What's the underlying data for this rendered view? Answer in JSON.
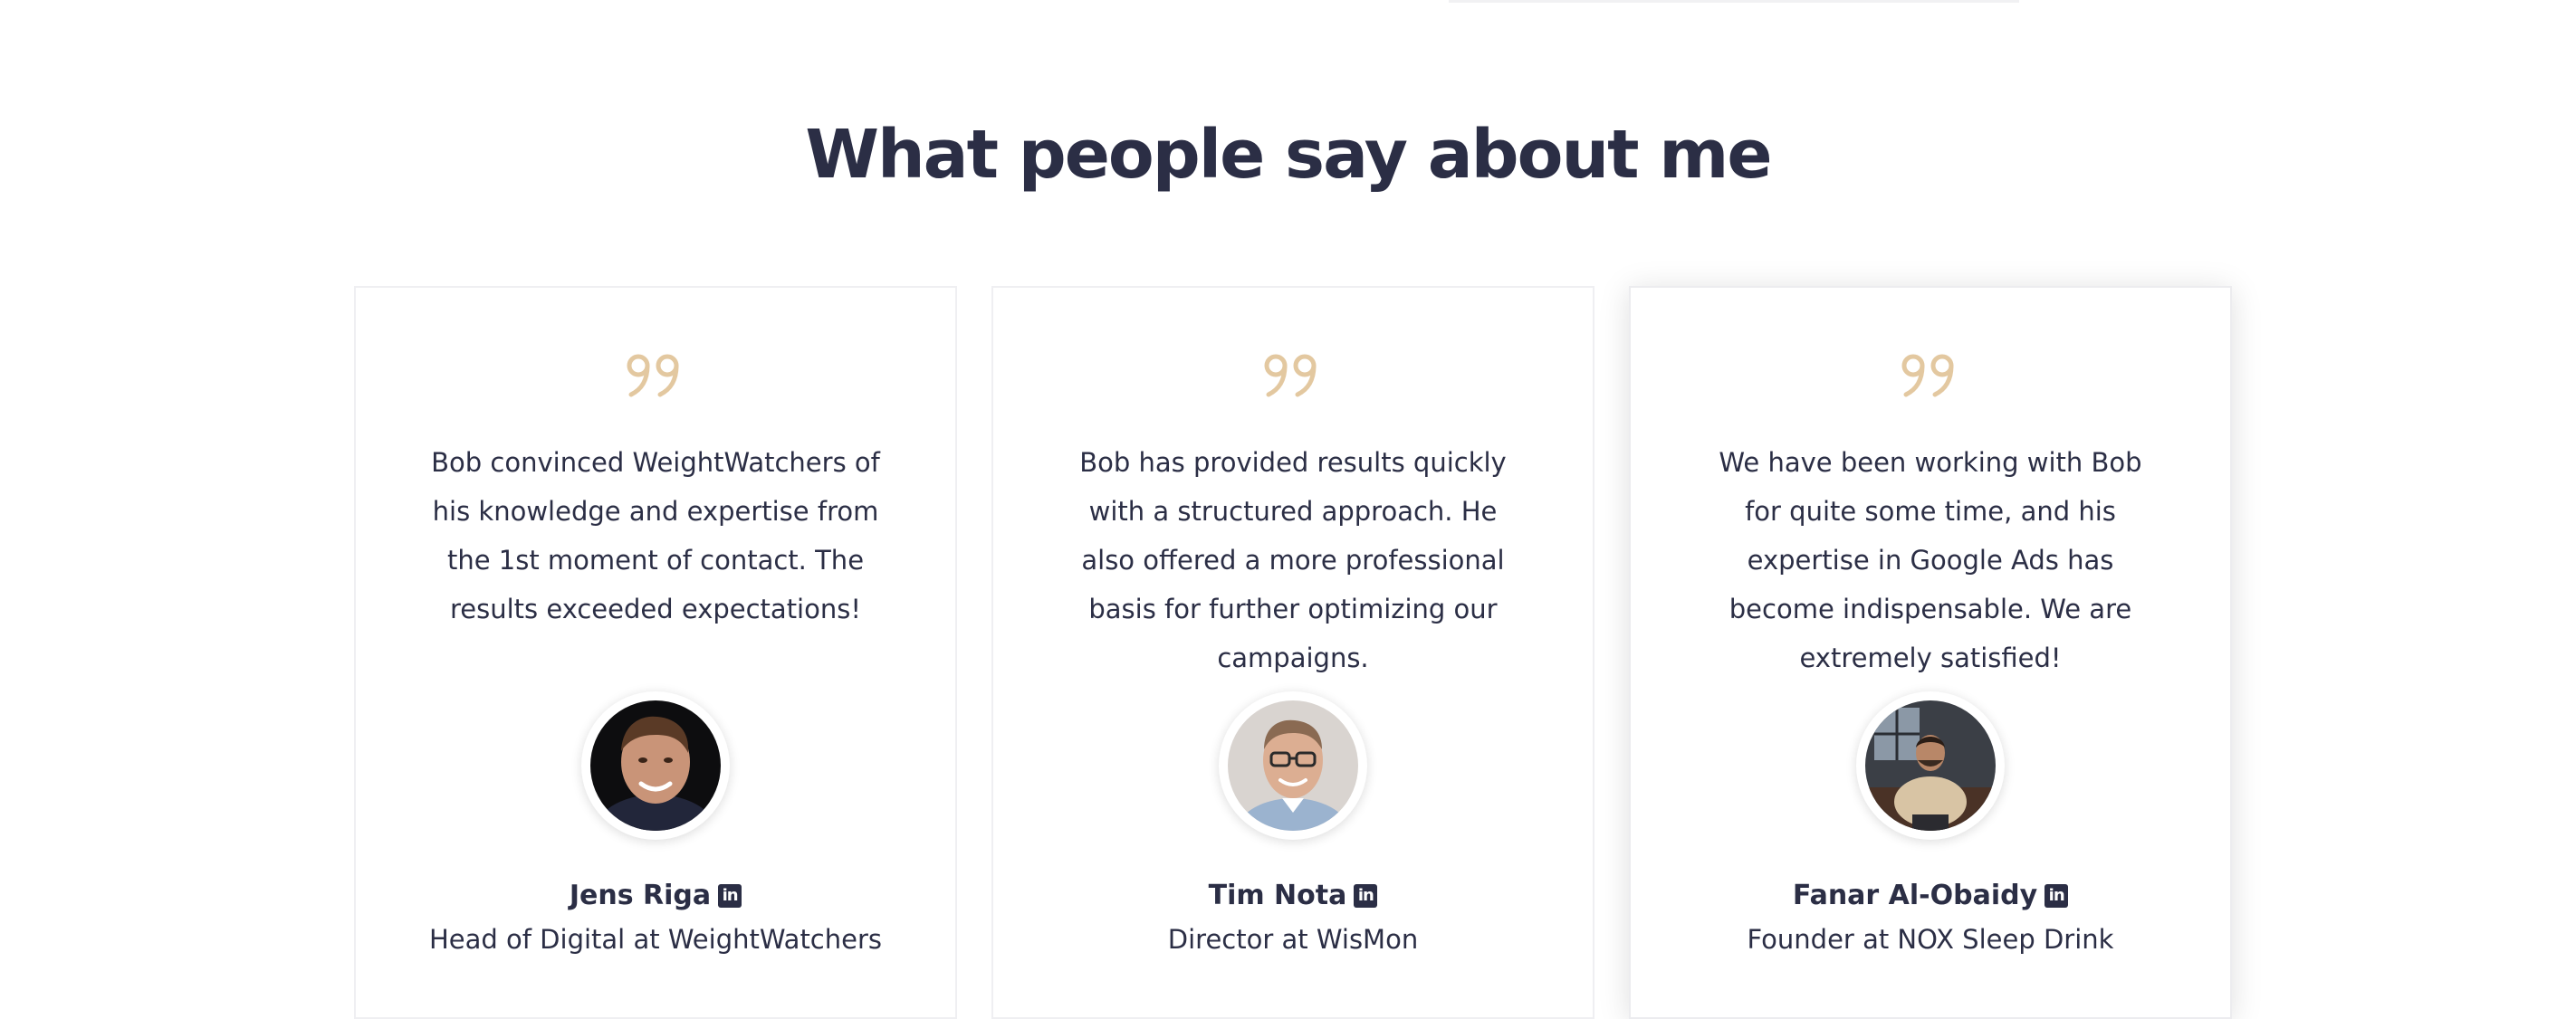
{
  "section": {
    "title": "What people say about me"
  },
  "colors": {
    "text": "#2b2e45",
    "quote_accent": "#e3c8a0",
    "card_border": "#efeff2"
  },
  "testimonials": [
    {
      "quote": "Bob convinced WeightWatchers of his knowledge and expertise from the 1st moment of contact. The results exceeded expectations!",
      "name": "Jens Riga",
      "role": "Head of Digital at WeightWatchers",
      "icon": "linkedin-icon"
    },
    {
      "quote": "Bob has provided results quickly with a structured approach. He also offered a more professional basis for further optimizing our campaigns.",
      "name": "Tim Nota",
      "role": "Director at WisMon",
      "icon": "linkedin-icon"
    },
    {
      "quote": "We have been working with Bob for quite some time, and his expertise in Google Ads has become indispensable. We are extremely satisfied!",
      "name": "Fanar Al-Obaidy",
      "role": "Founder at NOX Sleep Drink",
      "icon": "linkedin-icon"
    }
  ]
}
